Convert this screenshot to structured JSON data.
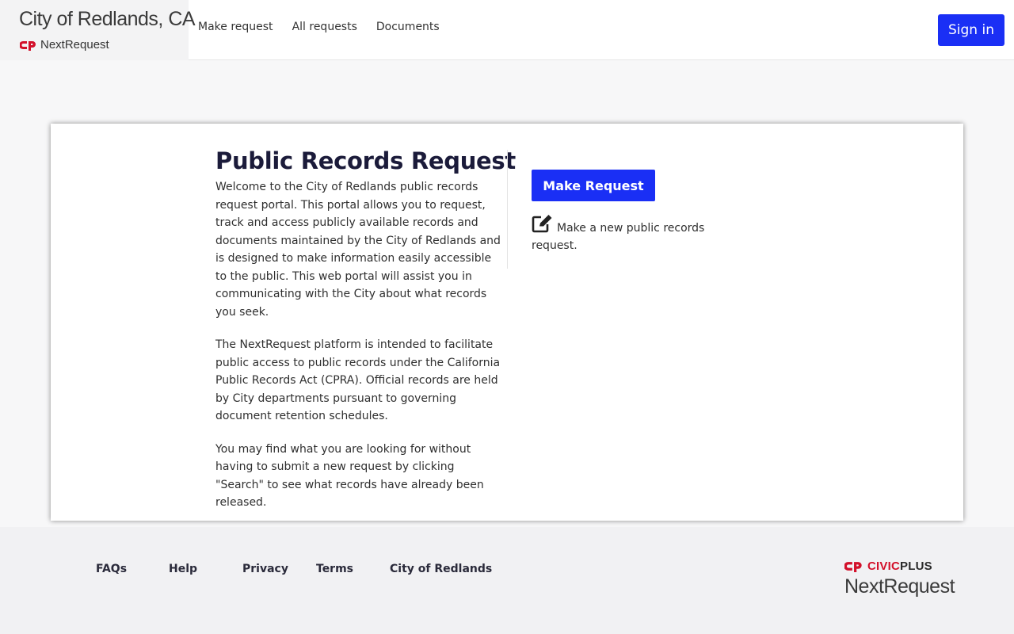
{
  "header": {
    "city_name": "City of Redlands, CA",
    "product_name": "NextRequest",
    "nav": [
      {
        "label": "Make request"
      },
      {
        "label": "All requests"
      },
      {
        "label": "Documents"
      }
    ],
    "signin_label": "Sign in"
  },
  "intro": {
    "title": "Public Records Request",
    "paragraphs": [
      "Welcome to the City of Redlands public records request portal. This portal allows you to request, track and access publicly available records and documents maintained by the City of Redlands and is designed to make information easily accessible to the public. This web portal will assist you in communicating with the City about what records you seek.",
      "The NextRequest platform is intended to facilitate public access to public records under the California Public Records Act (CPRA). Official records are held by City departments pursuant to governing document retention schedules.",
      "You may find what you are looking for without having to submit a new request by clicking \"Search\" to see what records have already been released."
    ]
  },
  "action": {
    "button_label": "Make Request",
    "description": "Make a new public records request.",
    "icon": "edit-icon"
  },
  "footer": {
    "links": [
      {
        "label": "FAQs"
      },
      {
        "label": "Help"
      },
      {
        "label": "Privacy"
      },
      {
        "label": "Terms"
      },
      {
        "label": "City of Redlands"
      }
    ],
    "civic_part": "CIVIC",
    "plus_part": "PLUS",
    "product_name": "NextRequest"
  },
  "colors": {
    "primary": "#1a2ff5",
    "brand_red": "#d3102a"
  }
}
